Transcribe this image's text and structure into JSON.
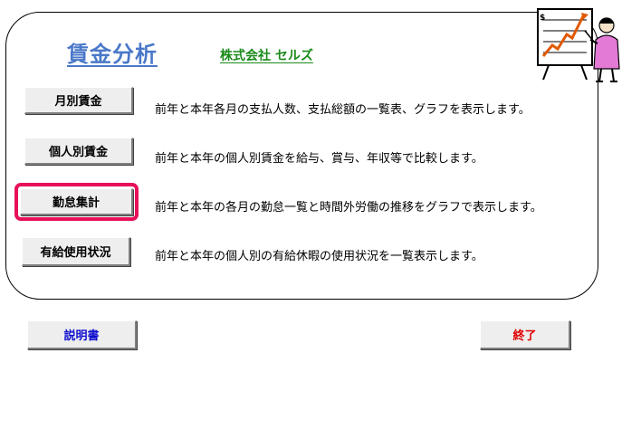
{
  "header": {
    "title": "賃金分析",
    "company": "株式会社 セルズ"
  },
  "menu": [
    {
      "label": "月別賃金",
      "description": "前年と本年各月の支払人数、支払総額の一覧表、グラフを表示します。"
    },
    {
      "label": "個人別賃金",
      "description": "前年と本年の個人別賃金を給与、賞与、年収等で比較します。"
    },
    {
      "label": "勤怠集計",
      "description": "前年と本年の各月の勤怠一覧と時間外労働の推移をグラフで表示します。"
    },
    {
      "label": "有給使用状況",
      "description": "前年と本年の個人別の有給休暇の使用状況を一覧表示します。"
    }
  ],
  "footer": {
    "manual_label": "説明書",
    "exit_label": "終了"
  },
  "icons": {
    "clipart": "presenter-with-chart-icon"
  },
  "colors": {
    "title": "#4a78c8",
    "company": "#1a8a1a",
    "selected_outline": "#e8105a",
    "manual_text": "#1010d0",
    "exit_text": "#e00000"
  }
}
